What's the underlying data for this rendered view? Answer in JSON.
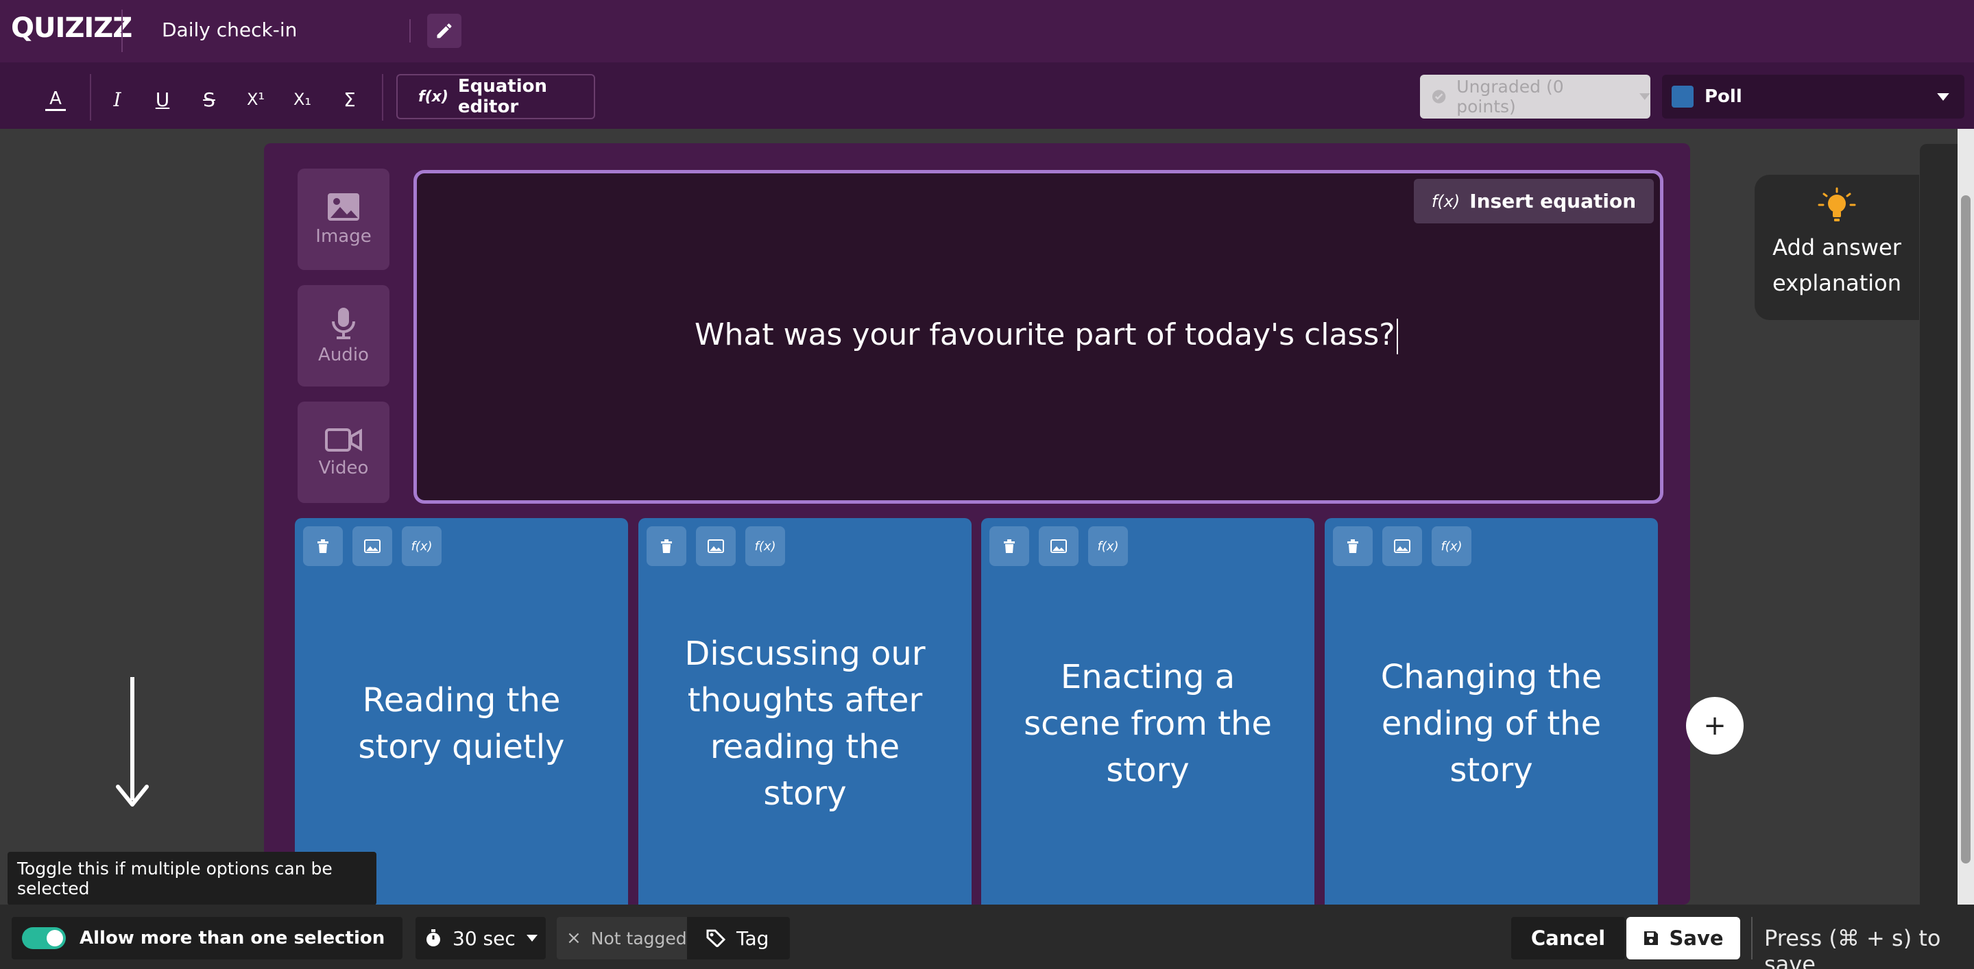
{
  "header": {
    "logo": "QUIZIZZ",
    "title": "Daily check-in"
  },
  "toolbar": {
    "format_buttons": [
      "A",
      "I",
      "U",
      "S",
      "X¹",
      "X₁",
      "Σ"
    ],
    "equation_editor_label": "Equation editor",
    "equation_icon": "f(x)",
    "grading_label": "Ungraded (0 points)",
    "question_type": "Poll"
  },
  "media": {
    "image_label": "Image",
    "audio_label": "Audio",
    "video_label": "Video"
  },
  "question": {
    "insert_equation_label": "Insert equation",
    "text": "What was your favourite part of today's class?"
  },
  "options": [
    {
      "text": "Reading the story quietly"
    },
    {
      "text": "Discussing our thoughts after reading the story"
    },
    {
      "text": "Enacting a scene from the story"
    },
    {
      "text": "Changing the ending of the story"
    }
  ],
  "add_option_label": "+",
  "answer_explanation": {
    "label": "Add answer explanation"
  },
  "tooltip": "Toggle this if multiple options can be selected",
  "footer": {
    "multi_select_label": "Allow more than one selection",
    "multi_select_enabled": true,
    "timer": "30 sec",
    "tag_status": "Not tagged",
    "tag_label": "Tag",
    "cancel_label": "Cancel",
    "save_label": "Save",
    "save_hint": "Press (⌘ + s) to save"
  },
  "colors": {
    "header_bg": "#461a4a",
    "option_bg": "#2d6dad",
    "question_border": "#a77bd0",
    "toggle_on": "#27b89a"
  }
}
